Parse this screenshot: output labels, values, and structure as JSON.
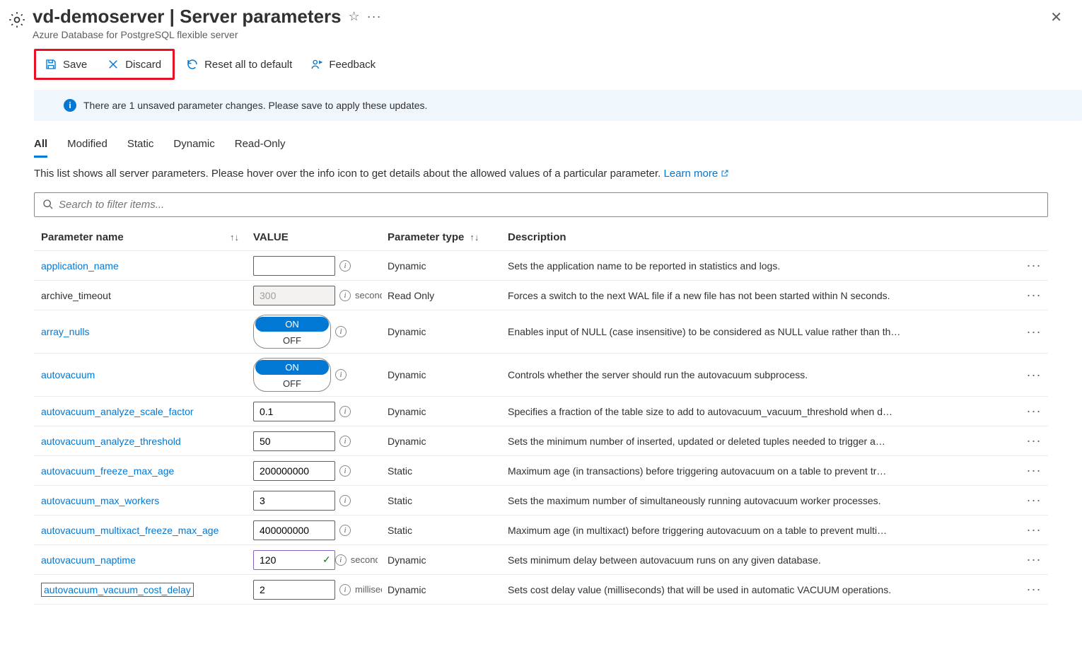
{
  "header": {
    "title": "vd-demoserver | Server parameters",
    "subtitle": "Azure Database for PostgreSQL flexible server"
  },
  "toolbar": {
    "save": "Save",
    "discard": "Discard",
    "reset": "Reset all to default",
    "feedback": "Feedback"
  },
  "notice": "There are 1 unsaved parameter changes.  Please save to apply these updates.",
  "tabs": {
    "all": "All",
    "modified": "Modified",
    "static": "Static",
    "dynamic": "Dynamic",
    "readonly": "Read-Only"
  },
  "description": "This list shows all server parameters. Please hover over the info icon to get details about the allowed values of a particular parameter. ",
  "learn_more": "Learn more",
  "search_placeholder": "Search to filter items...",
  "columns": {
    "name": "Parameter name",
    "value": "VALUE",
    "type": "Parameter type",
    "desc": "Description"
  },
  "rows": [
    {
      "name": "application_name",
      "link": true,
      "value": "",
      "input": "text",
      "unit": "",
      "type": "Dynamic",
      "desc": "Sets the application name to be reported in statistics and logs."
    },
    {
      "name": "archive_timeout",
      "link": false,
      "value": "300",
      "input": "readonly",
      "unit": "seconds",
      "type": "Read Only",
      "desc": "Forces a switch to the next WAL file if a new file has not been started within N seconds."
    },
    {
      "name": "array_nulls",
      "link": true,
      "value": "ON",
      "input": "toggle",
      "unit": "",
      "type": "Dynamic",
      "desc": "Enables input of NULL (case insensitive) to be considered as NULL value rather than th…"
    },
    {
      "name": "autovacuum",
      "link": true,
      "value": "ON",
      "input": "toggle",
      "unit": "",
      "type": "Dynamic",
      "desc": "Controls whether the server should run the autovacuum subprocess."
    },
    {
      "name": "autovacuum_analyze_scale_factor",
      "link": true,
      "value": "0.1",
      "input": "text",
      "unit": "",
      "type": "Dynamic",
      "desc": "Specifies a fraction of the table size to add to autovacuum_vacuum_threshold when d…"
    },
    {
      "name": "autovacuum_analyze_threshold",
      "link": true,
      "value": "50",
      "input": "text",
      "unit": "",
      "type": "Dynamic",
      "desc": "Sets the minimum number of inserted, updated or deleted tuples needed to trigger a…"
    },
    {
      "name": "autovacuum_freeze_max_age",
      "link": true,
      "value": "200000000",
      "input": "text",
      "unit": "",
      "type": "Static",
      "desc": "Maximum age (in transactions) before triggering autovacuum on a table to prevent tr…"
    },
    {
      "name": "autovacuum_max_workers",
      "link": true,
      "value": "3",
      "input": "text",
      "unit": "",
      "type": "Static",
      "desc": "Sets the maximum number of simultaneously running autovacuum worker processes."
    },
    {
      "name": "autovacuum_multixact_freeze_max_age",
      "link": true,
      "value": "400000000",
      "input": "text",
      "unit": "",
      "type": "Static",
      "desc": "Maximum age (in multixact) before triggering autovacuum on a table to prevent multi…"
    },
    {
      "name": "autovacuum_naptime",
      "link": true,
      "value": "120",
      "input": "changed",
      "unit": "seconds",
      "type": "Dynamic",
      "desc": "Sets minimum delay between autovacuum runs on any given database."
    },
    {
      "name": "autovacuum_vacuum_cost_delay",
      "link": true,
      "boxed": true,
      "value": "2",
      "input": "text",
      "unit": "milliseconds",
      "type": "Dynamic",
      "desc": "Sets cost delay value (milliseconds) that will be used in automatic VACUUM operations."
    }
  ],
  "toggle_labels": {
    "on": "ON",
    "off": "OFF"
  }
}
